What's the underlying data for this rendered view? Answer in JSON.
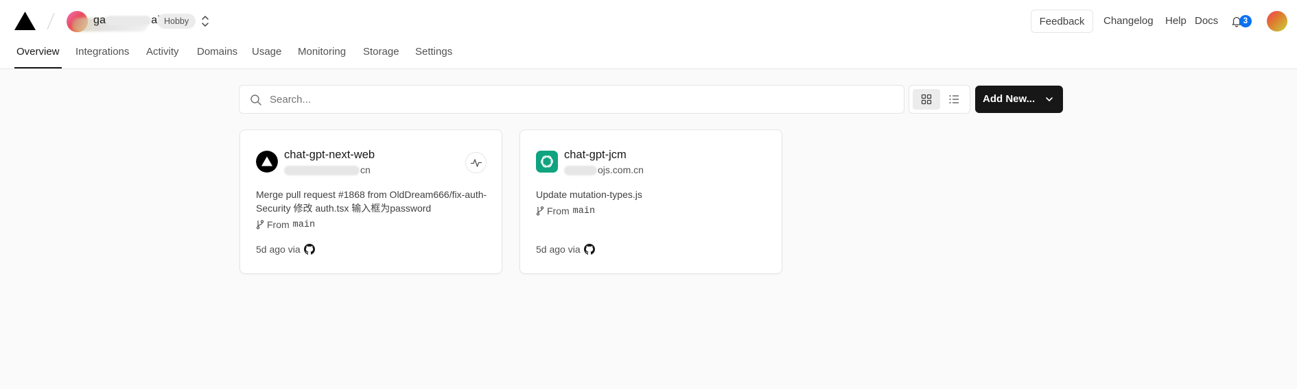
{
  "header": {
    "team": {
      "name_prefix": "ga",
      "name_suffix": "ai",
      "plan_badge": "Hobby"
    },
    "links": {
      "feedback": "Feedback",
      "changelog": "Changelog",
      "help": "Help",
      "docs": "Docs"
    },
    "notifications": {
      "count": "3"
    }
  },
  "tabs": [
    {
      "label": "Overview",
      "active": true
    },
    {
      "label": "Integrations"
    },
    {
      "label": "Activity"
    },
    {
      "label": "Domains"
    },
    {
      "label": "Usage"
    },
    {
      "label": "Monitoring"
    },
    {
      "label": "Storage"
    },
    {
      "label": "Settings"
    }
  ],
  "toolbar": {
    "search_placeholder": "Search...",
    "add_new_label": "Add New..."
  },
  "projects": [
    {
      "name": "chat-gpt-next-web",
      "domain_suffix": "cn",
      "commit_message": "Merge pull request #1868 from OldDream666/fix-auth-Security 修改 auth.tsx 输入框为password",
      "branch_prefix": "From",
      "branch": "main",
      "time": "5d ago via",
      "icon": "vercel-triangle-icon"
    },
    {
      "name": "chat-gpt-jcm",
      "domain_suffix": "ojs.com.cn",
      "commit_message": "Update mutation-types.js",
      "branch_prefix": "From",
      "branch": "main",
      "time": "5d ago via",
      "icon": "openai-icon"
    }
  ],
  "colors": {
    "accent": "#0a72ef",
    "primary_button": "#171717",
    "background": "#fafafa",
    "openai_green": "#10a37f"
  }
}
